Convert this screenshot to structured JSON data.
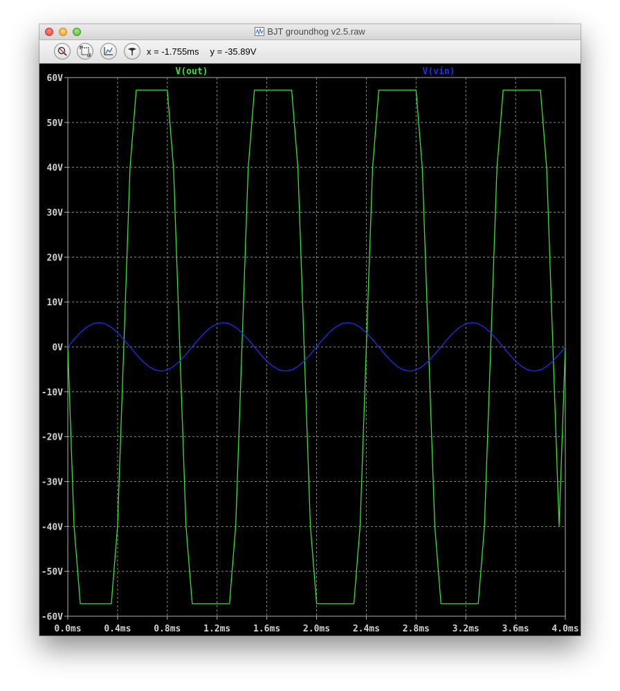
{
  "window": {
    "title": "BJT groundhog v2.5.raw"
  },
  "toolbar": {
    "buttons": [
      {
        "name": "zoom-area-icon"
      },
      {
        "name": "zoom-full-icon"
      },
      {
        "name": "autorange-icon"
      },
      {
        "name": "probe-icon"
      }
    ],
    "cursor_x": "x = -1.755ms",
    "cursor_y": "y = -35.89V"
  },
  "colors": {
    "background": "#000000",
    "grid": "#8c8c8c",
    "axis_text": "#d0d0d0",
    "vout": "#32e632",
    "vin": "#1f2ff0"
  },
  "chart_data": {
    "type": "line",
    "title": "",
    "xlabel": "",
    "ylabel": "",
    "xlim": [
      0,
      4.0
    ],
    "ylim": [
      -60,
      60
    ],
    "grid": true,
    "legend_position": "top",
    "x_ticks": [
      "0.0ms",
      "0.4ms",
      "0.8ms",
      "1.2ms",
      "1.6ms",
      "2.0ms",
      "2.4ms",
      "2.8ms",
      "3.2ms",
      "3.6ms",
      "4.0ms"
    ],
    "x_tick_values": [
      0.0,
      0.4,
      0.8,
      1.2,
      1.6,
      2.0,
      2.4,
      2.8,
      3.2,
      3.6,
      4.0
    ],
    "y_ticks": [
      "60V",
      "50V",
      "40V",
      "30V",
      "20V",
      "10V",
      "0V",
      "-10V",
      "-20V",
      "-30V",
      "-40V",
      "-50V",
      "-60V"
    ],
    "y_tick_values": [
      60,
      50,
      40,
      30,
      20,
      10,
      0,
      -10,
      -20,
      -30,
      -40,
      -50,
      -60
    ],
    "series": [
      {
        "name": "V(out)",
        "color": "#32e632",
        "x": [
          0.0,
          0.05,
          0.1,
          0.15,
          0.2,
          0.25,
          0.3,
          0.35,
          0.4,
          0.45,
          0.5,
          0.55,
          0.6,
          0.65,
          0.7,
          0.75,
          0.8,
          0.85,
          0.9,
          0.95,
          1.0,
          1.05,
          1.1,
          1.15,
          1.2,
          1.25,
          1.3,
          1.35,
          1.4,
          1.45,
          1.5,
          1.55,
          1.6,
          1.65,
          1.7,
          1.75,
          1.8,
          1.85,
          1.9,
          1.95,
          2.0,
          2.05,
          2.1,
          2.15,
          2.2,
          2.25,
          2.3,
          2.35,
          2.4,
          2.45,
          2.5,
          2.55,
          2.6,
          2.65,
          2.7,
          2.75,
          2.8,
          2.85,
          2.9,
          2.95,
          3.0,
          3.05,
          3.1,
          3.15,
          3.2,
          3.25,
          3.3,
          3.35,
          3.4,
          3.45,
          3.5,
          3.55,
          3.6,
          3.65,
          3.7,
          3.75,
          3.8,
          3.85,
          3.9,
          3.95,
          4.0
        ],
        "values": [
          0.0,
          -39.8,
          -57.2,
          -57.2,
          -57.2,
          -57.2,
          -57.2,
          -57.2,
          -39.8,
          0.0,
          39.8,
          57.2,
          57.2,
          57.2,
          57.2,
          57.2,
          57.2,
          39.8,
          0.0,
          -39.8,
          -57.2,
          -57.2,
          -57.2,
          -57.2,
          -57.2,
          -57.2,
          -57.2,
          -39.8,
          0.0,
          39.8,
          57.2,
          57.2,
          57.2,
          57.2,
          57.2,
          57.2,
          57.2,
          39.8,
          0.0,
          -39.8,
          -57.2,
          -57.2,
          -57.2,
          -57.2,
          -57.2,
          -57.2,
          -57.2,
          -39.8,
          0.0,
          39.8,
          57.2,
          57.2,
          57.2,
          57.2,
          57.2,
          57.2,
          57.2,
          39.8,
          0.0,
          -39.8,
          -57.2,
          -57.2,
          -57.2,
          -57.2,
          -57.2,
          -57.2,
          -57.2,
          -39.8,
          0.0,
          39.8,
          57.2,
          57.2,
          57.2,
          57.2,
          57.2,
          57.2,
          57.2,
          39.8,
          0.0,
          -39.8,
          0.0
        ]
      },
      {
        "name": "V(vin)",
        "color": "#1f2ff0",
        "x": [
          0.0,
          0.05,
          0.1,
          0.15,
          0.2,
          0.25,
          0.3,
          0.35,
          0.4,
          0.45,
          0.5,
          0.55,
          0.6,
          0.65,
          0.7,
          0.75,
          0.8,
          0.85,
          0.9,
          0.95,
          1.0,
          1.05,
          1.1,
          1.15,
          1.2,
          1.25,
          1.3,
          1.35,
          1.4,
          1.45,
          1.5,
          1.55,
          1.6,
          1.65,
          1.7,
          1.75,
          1.8,
          1.85,
          1.9,
          1.95,
          2.0,
          2.05,
          2.1,
          2.15,
          2.2,
          2.25,
          2.3,
          2.35,
          2.4,
          2.45,
          2.5,
          2.55,
          2.6,
          2.65,
          2.7,
          2.75,
          2.8,
          2.85,
          2.9,
          2.95,
          3.0,
          3.05,
          3.1,
          3.15,
          3.2,
          3.25,
          3.3,
          3.35,
          3.4,
          3.45,
          3.5,
          3.55,
          3.6,
          3.65,
          3.7,
          3.75,
          3.8,
          3.85,
          3.9,
          3.95,
          4.0
        ],
        "values": [
          0.0,
          1.67,
          3.17,
          4.37,
          5.14,
          5.4,
          5.14,
          4.37,
          3.17,
          1.67,
          0.0,
          -1.67,
          -3.17,
          -4.37,
          -5.14,
          -5.4,
          -5.14,
          -4.37,
          -3.17,
          -1.67,
          0.0,
          1.67,
          3.17,
          4.37,
          5.14,
          5.4,
          5.14,
          4.37,
          3.17,
          1.67,
          0.0,
          -1.67,
          -3.17,
          -4.37,
          -5.14,
          -5.4,
          -5.14,
          -4.37,
          -3.17,
          -1.67,
          0.0,
          1.67,
          3.17,
          4.37,
          5.14,
          5.4,
          5.14,
          4.37,
          3.17,
          1.67,
          0.0,
          -1.67,
          -3.17,
          -4.37,
          -5.14,
          -5.4,
          -5.14,
          -4.37,
          -3.17,
          -1.67,
          0.0,
          1.67,
          3.17,
          4.37,
          5.14,
          5.4,
          5.14,
          4.37,
          3.17,
          1.67,
          0.0,
          -1.67,
          -3.17,
          -4.37,
          -5.14,
          -5.4,
          -5.14,
          -4.37,
          -3.17,
          -1.67,
          0.0
        ]
      }
    ]
  }
}
